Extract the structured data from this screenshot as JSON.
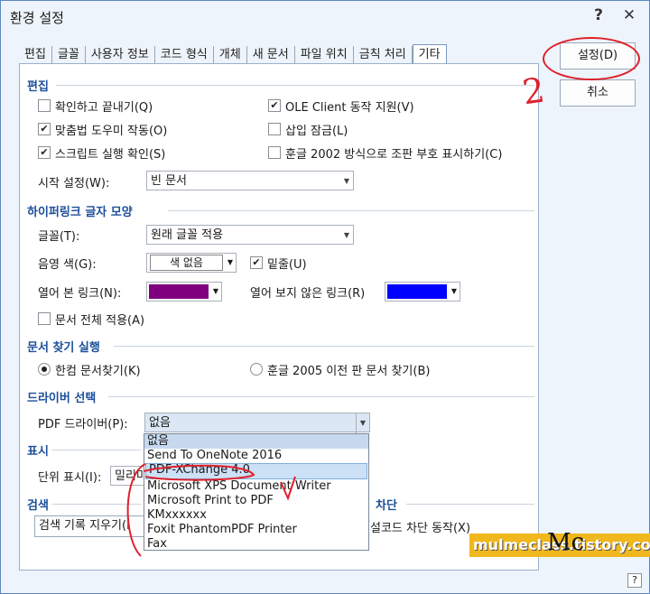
{
  "window": {
    "title": "환경 설정",
    "help_icon": "?",
    "close_icon": "✕"
  },
  "tabs": [
    "편집",
    "글꼴",
    "사용자 정보",
    "코드 형식",
    "개체",
    "새 문서",
    "파일 위치",
    "금칙 처리",
    "기타"
  ],
  "buttons": {
    "ok": "설정(D)",
    "cancel": "취소"
  },
  "sections": {
    "edit": {
      "title": "편집",
      "options": [
        {
          "label": "확인하고 끝내기(Q)",
          "checked": false
        },
        {
          "label": "OLE Client 동작 지원(V)",
          "checked": true
        },
        {
          "label": "맞춤법 도우미 작동(O)",
          "checked": true
        },
        {
          "label": "삽입 잠금(L)",
          "checked": false
        },
        {
          "label": "스크립트 실행 확인(S)",
          "checked": true
        },
        {
          "label": "훈글 2002 방식으로 조판 부호 표시하기(C)",
          "checked": false
        }
      ],
      "start_label": "시작 설정(W):",
      "start_value": "빈 문서"
    },
    "hyperlink": {
      "title": "하이퍼링크 글자 모양",
      "font_label": "글꼴(T):",
      "font_value": "원래 글꼴 적용",
      "shade_label": "음영 색(G):",
      "shade_value": "색 없음",
      "underline_label": "밑줄(U)",
      "visited_label": "열어 본 링크(N):",
      "visited_color": "#800080",
      "unvisited_label": "열어 보지 않은 링크(R)",
      "unvisited_color": "#0000ff",
      "apply_all_label": "문서 전체 적용(A)"
    },
    "find": {
      "title": "문서 찾기 실행",
      "opt1": "한컴 문서찾기(K)",
      "opt2": "훈글 2005 이전 판 문서 찾기(B)"
    },
    "driver": {
      "title": "드라이버 선택",
      "pdf_label": "PDF 드라이버(P):",
      "pdf_value": "없음",
      "options": [
        "없음",
        "Send To OneNote 2016",
        "PDF-XChange 4.0",
        "Microsoft XPS Document Writer",
        "Microsoft Print to PDF",
        "KMxxxxxx",
        "Foxit PhantomPDF Printer",
        "Fax"
      ]
    },
    "display": {
      "title": "표시",
      "unit_label": "단위 표시(I):",
      "unit_value": "밀리미"
    },
    "search": {
      "title": "검색",
      "clear_value": "검색 기록 지우기(I"
    },
    "block": {
      "title": "차단",
      "barcode_label": "설코드 차단 동작(X)"
    }
  },
  "annotations": {
    "number": "2"
  },
  "watermark": {
    "site": "mulmeclass.tistory.com",
    "logo": "Mc"
  },
  "help_box": "?"
}
